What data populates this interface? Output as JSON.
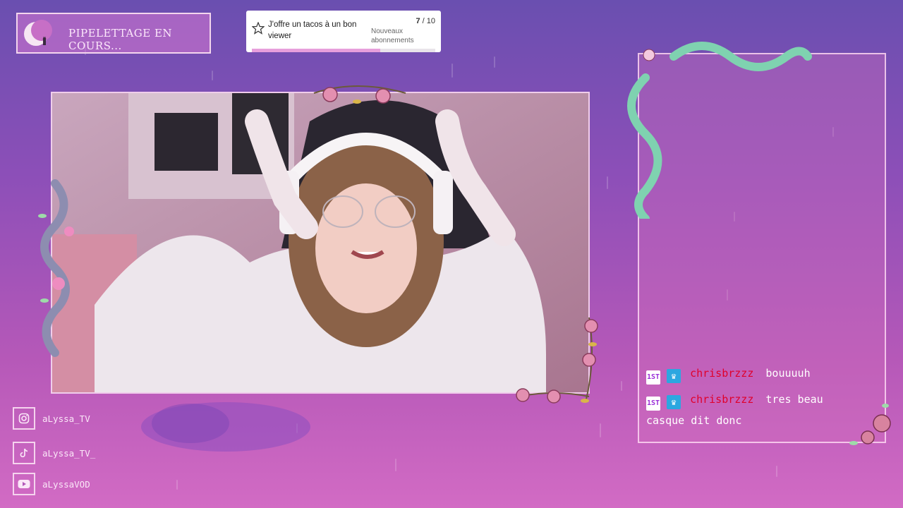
{
  "status": {
    "text": "PIPELETTAGE EN COURS..."
  },
  "goal": {
    "title": "J'offre un tacos à un bon viewer",
    "current": "7",
    "total": "/ 10",
    "subtitle": "Nouveaux abonnements",
    "progress_fraction": 0.7,
    "icon": "star-icon"
  },
  "socials": [
    {
      "platform": "instagram",
      "handle": "aLyssa_TV",
      "icon": "instagram-icon"
    },
    {
      "platform": "tiktok",
      "handle": "aLyssa_TV_",
      "icon": "tiktok-icon"
    },
    {
      "platform": "youtube",
      "handle": "aLyssaVOD",
      "icon": "youtube-icon"
    }
  ],
  "chat": {
    "messages": [
      {
        "badge": "1ST",
        "username": "chrisbrzzz",
        "text": "bouuuuh"
      },
      {
        "badge": "1ST",
        "username": "chrisbrzzz",
        "text": "tres beau casque dit donc"
      }
    ]
  },
  "colors": {
    "accent_pink": "#e79fdc",
    "chat_username": "#e0002a",
    "frame_border": "#f0cdeb"
  }
}
